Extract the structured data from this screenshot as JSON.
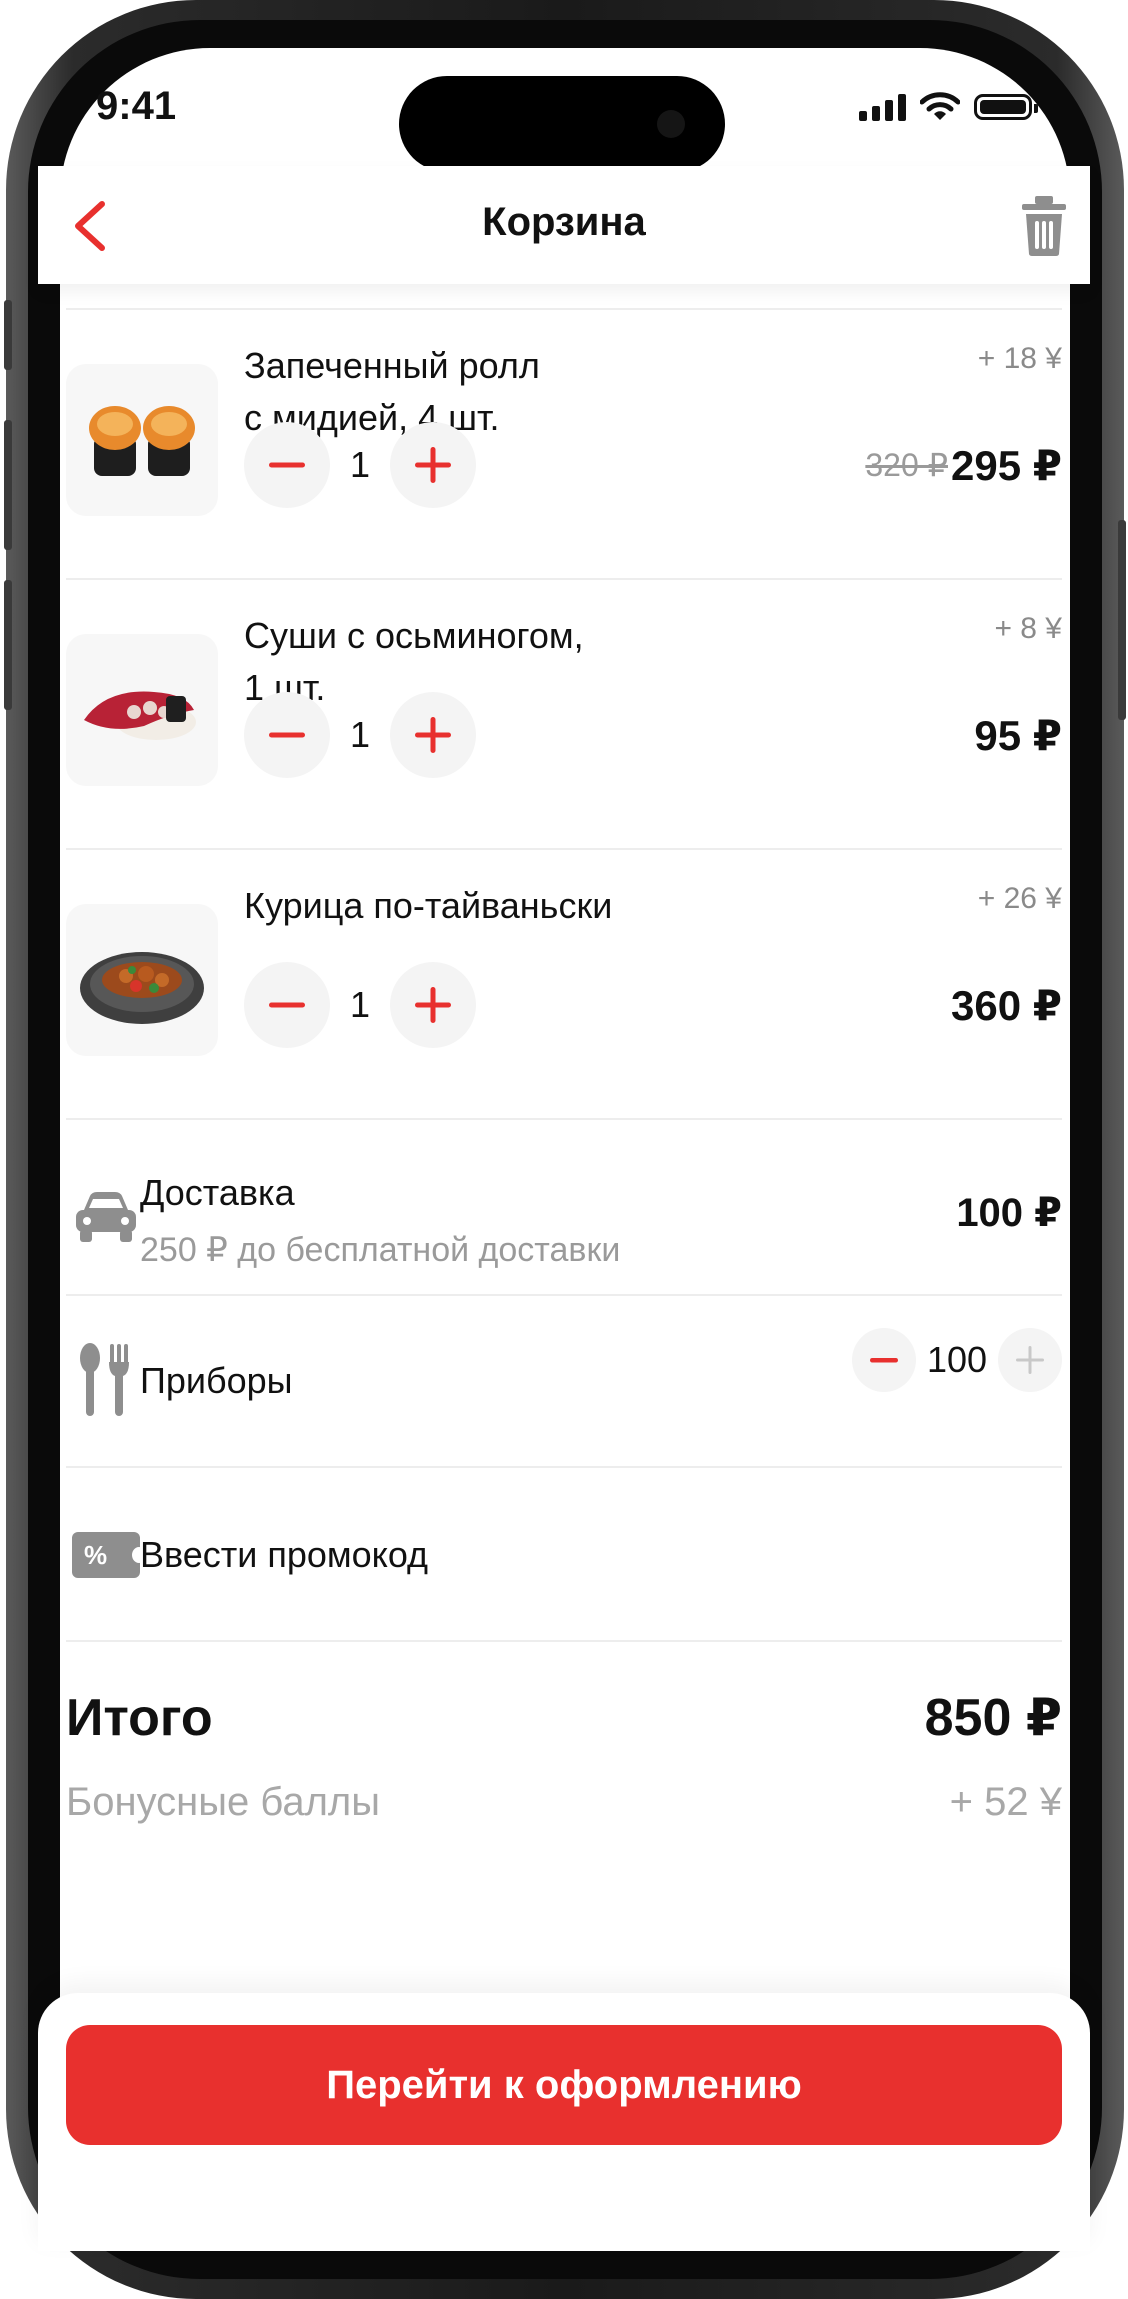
{
  "status_bar": {
    "time": "9:41"
  },
  "header": {
    "title": "Корзина"
  },
  "items": [
    {
      "name_line1": "Запеченный ролл",
      "name_line2": "с мидией, 4 шт.",
      "bonus": "+ 18 ¥",
      "quantity": "1",
      "old_price": "320 ₽",
      "price": "295 ₽"
    },
    {
      "name_line1": "Суши с осьминогом,",
      "name_line2": "1 шт.",
      "bonus": "+ 8 ¥",
      "quantity": "1",
      "old_price": "",
      "price": "95 ₽"
    },
    {
      "name_line1": "Курица по-тайваньски",
      "name_line2": "",
      "bonus": "+ 26 ¥",
      "quantity": "1",
      "old_price": "",
      "price": "360 ₽"
    }
  ],
  "delivery": {
    "label": "Доставка",
    "subtitle": "250 ₽ до бесплатной доставки",
    "price": "100 ₽"
  },
  "cutlery": {
    "label": "Приборы",
    "value": "100"
  },
  "promo": {
    "label": "Ввести промокод",
    "icon_text": "%"
  },
  "summary": {
    "total_label": "Итого",
    "total_value": "850 ₽",
    "bonus_label": "Бонусные баллы",
    "bonus_value": "+ 52 ¥"
  },
  "checkout": {
    "button_label": "Перейти к оформлению"
  },
  "colors": {
    "accent": "#e8302e",
    "text": "#111111",
    "muted": "#9a9a9a",
    "icon_gray": "#8e8e8e"
  }
}
